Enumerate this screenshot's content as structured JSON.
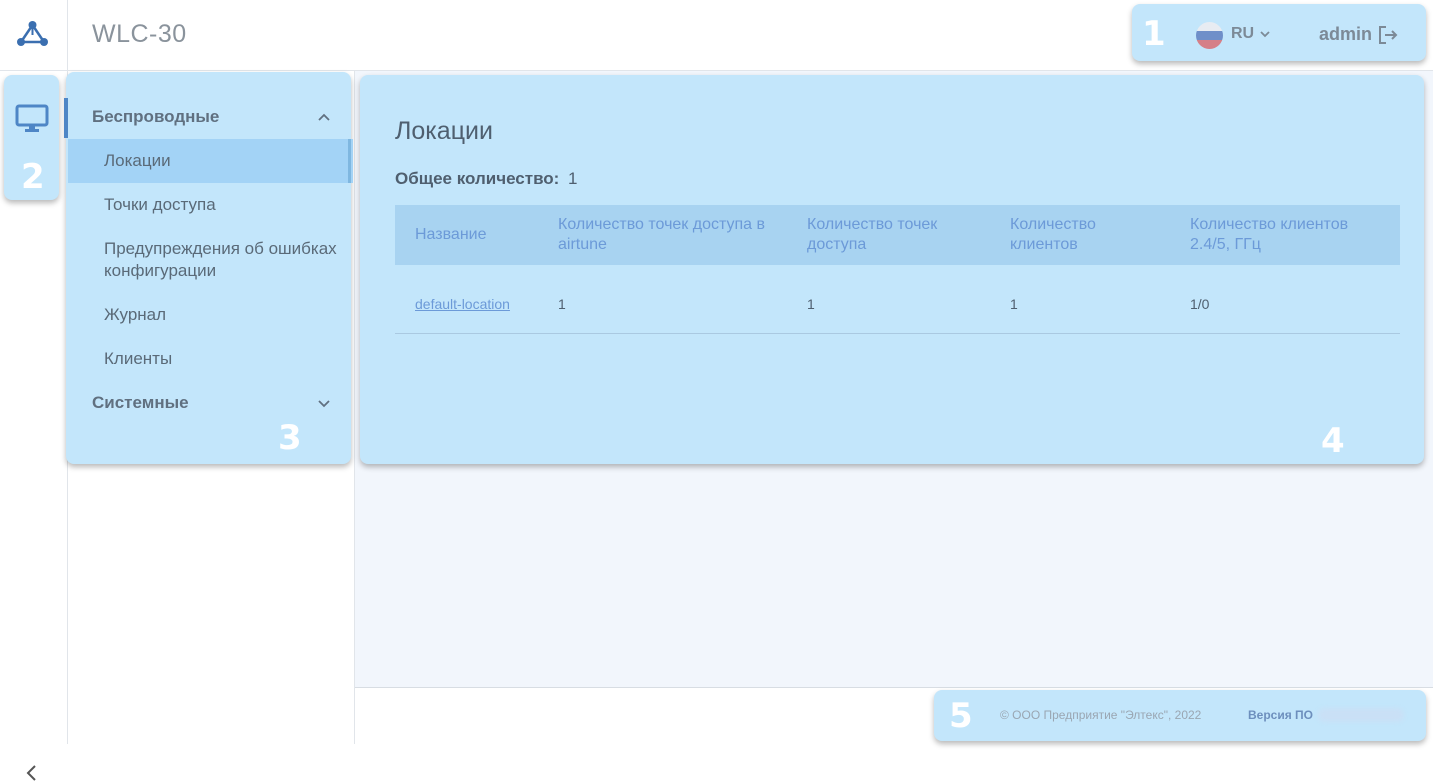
{
  "header": {
    "app_title": "WLC-30",
    "language": "RU",
    "username": "admin"
  },
  "markers": [
    "1",
    "2",
    "3",
    "4",
    "5"
  ],
  "sidebar": {
    "groups": [
      {
        "label": "Беспроводные",
        "expanded": true,
        "items": [
          {
            "label": "Локации",
            "active": true
          },
          {
            "label": "Точки доступа"
          },
          {
            "label": "Предупреждения об ошибках конфигурации"
          },
          {
            "label": "Журнал"
          },
          {
            "label": "Клиенты"
          }
        ]
      },
      {
        "label": "Системные",
        "expanded": false
      }
    ]
  },
  "main": {
    "title": "Локации",
    "total_label": "Общее количество:",
    "total_value": "1",
    "table": {
      "columns": [
        "Название",
        "Количество точек доступа в airtune",
        "Количество точек доступа",
        "Количество клиентов",
        "Количество клиентов 2.4/5, ГГц"
      ],
      "rows": [
        [
          "default-location",
          "1",
          "1",
          "1",
          "1/0"
        ]
      ]
    }
  },
  "footer": {
    "copyright": "© ООО Предприятие \"Элтекс\", 2022",
    "version_label": "Версия ПО"
  },
  "colors": {
    "highlight": "#c3e6fb",
    "active_menu": "#a3d3f6",
    "link": "#6c9ad8",
    "accent": "#4e86c6"
  },
  "icons": {
    "logo": "network-nodes-icon",
    "monitor": "monitor-icon",
    "language": "russia-flag-icon",
    "logout": "logout-icon",
    "collapse": "chevron-left-icon"
  }
}
